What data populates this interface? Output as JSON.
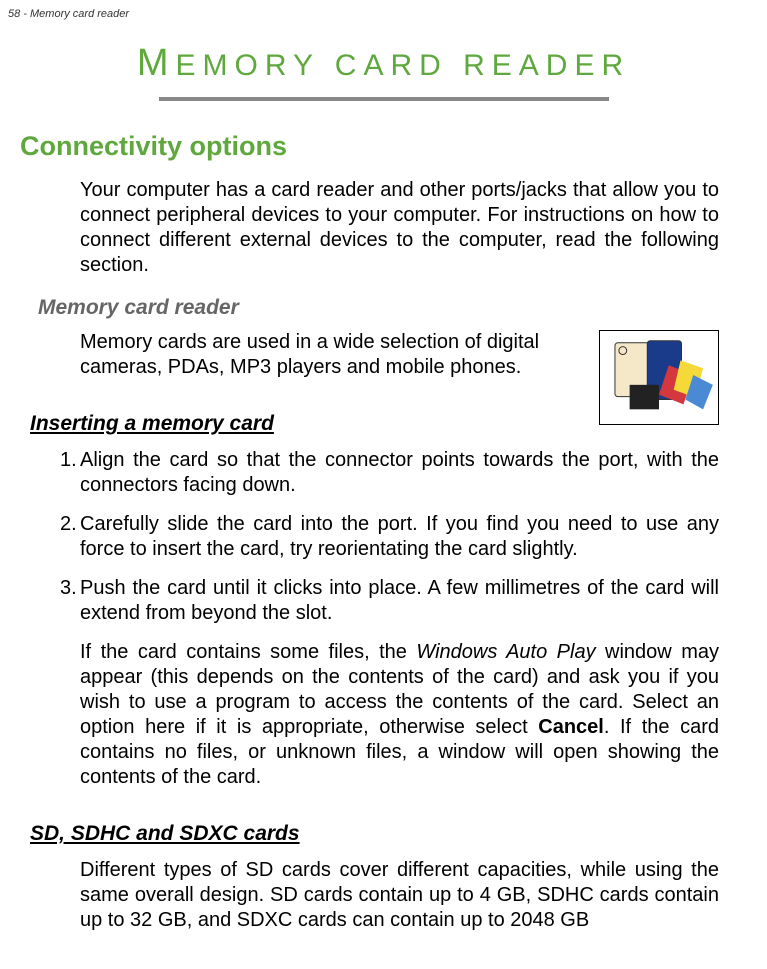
{
  "header": "58 - Memory card reader",
  "title": "MEMORY CARD READER",
  "section1": {
    "heading": "Connectivity options",
    "body": "Your computer has a card reader and other ports/jacks that allow you to connect peripheral devices to your computer. For instructions on how to connect different external devices to the computer, read the following section."
  },
  "subsection1": {
    "heading": "Memory card reader",
    "body": "Memory cards are used in a wide selection of digital cameras, PDAs, MP3 players and mobile phones."
  },
  "subsection2": {
    "heading": "Inserting a memory card",
    "items": [
      "Align the card so that the connector points towards the port, with the connectors facing down.",
      "Carefully slide the card into the port. If you find you need to use any force to insert the card, try reorientating the card slightly.",
      "Push the card until it clicks into place. A few millimetres of the card will extend from beyond the slot."
    ],
    "continuation_pre": "If the card contains some files, the ",
    "continuation_italic": "Windows Auto Play",
    "continuation_mid": " window may appear (this depends on the contents of the card) and ask you if you wish to use a program to access the contents of the card. Select an option here if it is appropriate, otherwise select ",
    "continuation_bold": "Cancel",
    "continuation_post": ". If the card contains no files, or unknown files, a window will open showing the contents of the card."
  },
  "subsection3": {
    "heading": "SD, SDHC and SDXC cards",
    "body": "Different types of SD cards cover different capacities, while using the same overall design. SD cards contain up to 4 GB, SDHC cards contain up to 32 GB, and SDXC cards can contain up to 2048 GB"
  }
}
